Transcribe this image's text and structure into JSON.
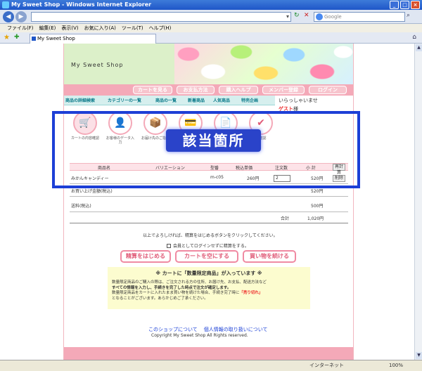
{
  "window": {
    "title": "My Sweet Shop - Windows Internet Explorer",
    "search_placeholder": "Google",
    "tab_title": "My Sweet Shop",
    "menu": [
      "ファイル(F)",
      "編集(E)",
      "表示(V)",
      "お気に入り(A)",
      "ツール(T)",
      "ヘルプ(H)"
    ],
    "status_zone": "インターネット",
    "zoom": "100%"
  },
  "shop": {
    "logo": "My Sweet Shop",
    "nav_buttons": [
      "カートを見る",
      "お支払方法",
      "購入ヘルプ",
      "メンバー登録",
      "ログイン"
    ],
    "categories": [
      "商品の詳細検索",
      "カテゴリーの一覧",
      "商品の一覧",
      "新着商品",
      "人気商品",
      "特売企画"
    ],
    "welcome": "いらっしゃいませ",
    "guest_name": "ゲスト",
    "guest_suffix": "様"
  },
  "steps": [
    {
      "label": "カートの内容確認",
      "icon": "🛒"
    },
    {
      "label": "お客様のデータ入力",
      "icon": "👤"
    },
    {
      "label": "お届け先のご指定",
      "icon": "📦"
    },
    {
      "label": "",
      "icon": "💳"
    },
    {
      "label": "",
      "icon": "📄"
    },
    {
      "label": "の確認",
      "icon": "✔"
    }
  ],
  "overlay_title": "該当箇所",
  "cart": {
    "headers": [
      "商品名",
      "バリエーション",
      "型番",
      "税込単価",
      "注文数",
      "小 計"
    ],
    "delete_all": "再計算",
    "items": [
      {
        "name": "みかんキャンディー",
        "variation": "",
        "model": "m-c05",
        "unit_price": "260円",
        "qty": "2",
        "subtotal": "520円",
        "remove": "削除"
      }
    ],
    "summary": [
      {
        "label": "お買い上げ金額(税込)",
        "value": "520円"
      },
      {
        "label": "送料(税込)",
        "value": "500円"
      }
    ],
    "total_label": "合計",
    "total_value": "1,020円"
  },
  "confirm_note": "以上でよろしければ、精算をはじめるボタンをクリックしてください。",
  "checkout_no_login": "会員としてログインせずに精算をする。",
  "actions": [
    "精算をはじめる",
    "カートを空にする",
    "買い物を続ける"
  ],
  "notice": {
    "title": "※ カートに「数量限定商品」が入っています ※",
    "line1": "数量限定商品のご購入の際は、ご注文される方の住所、お届け先、お支払、配送方法など",
    "line2": "すべての情報を入力し、手続きを完了した時点で注文が確定します。",
    "line3": "数量限定商品をカートに入れたまま買い物を続けた場合、手続き完了時に",
    "red": "「売り切れ」",
    "line4": "となることがございます。あらかじめご了承ください。"
  },
  "footer": {
    "link_about": "このショップについて",
    "link_privacy": "個人情報の取り扱いについて",
    "copyright": "Copyright My Sweet Shop All Rights reserved."
  }
}
